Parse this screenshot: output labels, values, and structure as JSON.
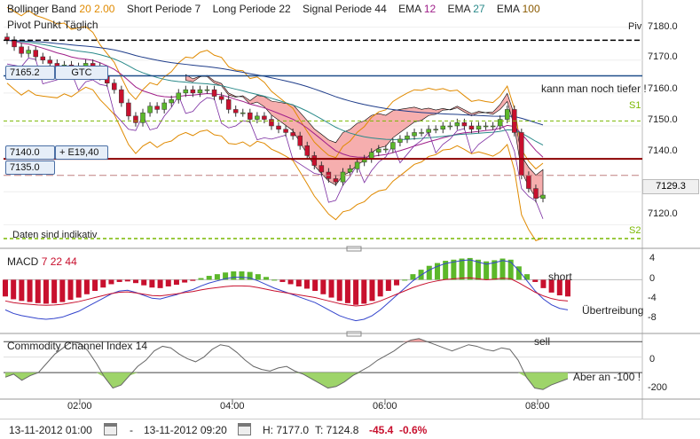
{
  "header": {
    "items": [
      {
        "label": "Bollinger Band",
        "vals": [
          "20",
          "2.00"
        ],
        "color": "#e08a00"
      },
      {
        "label": "Short Periode",
        "vals": [
          "7"
        ],
        "color": "#333333"
      },
      {
        "label": "Long Periode",
        "vals": [
          "22"
        ],
        "color": "#333333"
      },
      {
        "label": "Signal Periode",
        "vals": [
          "44"
        ],
        "color": "#333333"
      },
      {
        "label": "EMA",
        "vals": [
          "12"
        ],
        "color": "#a0208a"
      },
      {
        "label": "EMA",
        "vals": [
          "27"
        ],
        "color": "#2a8a8a"
      },
      {
        "label": "EMA",
        "vals": [
          "100"
        ],
        "color": "#8a5a00"
      }
    ],
    "subtitle": "Pivot Punkt Täglich"
  },
  "price_panel": {
    "pivot_label": "Piv",
    "s1_label": "S1",
    "s2_label": "S2",
    "indicative_note": "Daten sind indikativ",
    "annotation_top": "kann man noch tiefer !",
    "order_gtc": {
      "price": "7165.2",
      "tag": "GTC"
    },
    "order_e": {
      "price": "7140.0",
      "tag": "+ E19,40"
    },
    "order_stop": {
      "price": "7135.0"
    },
    "last_price": "7129.3",
    "y_ticks": [
      "7180.0",
      "7170.0",
      "7160.0",
      "7150.0",
      "7140.0",
      "7120.0"
    ]
  },
  "macd_panel": {
    "title": "MACD",
    "params": [
      "7",
      "22",
      "44"
    ],
    "annotation_short": "short",
    "annotation_ubertreibung": "Übertreibung",
    "y_ticks": [
      "4",
      "0",
      "-4",
      "-8"
    ]
  },
  "cci_panel": {
    "title": "Commodity Channel Index",
    "param": "14",
    "annotation_sell": "sell",
    "annotation_aber": "Aber an -100 !",
    "y_ticks": [
      "0",
      "-200"
    ]
  },
  "x_axis": {
    "ticks": [
      "02:00",
      "04:00",
      "06:00",
      "08:00"
    ]
  },
  "footer": {
    "from": "13-11-2012 01:00",
    "dash": "-",
    "to": "13-11-2012 09:20",
    "high": "H: 7177.0",
    "low": "T: 7124.8",
    "change": "-45.4",
    "change_pct": "-0.6%"
  },
  "colors": {
    "up": "#5cb82a",
    "down": "#c8102e",
    "cloud": "#f5a0a0",
    "pivot": "#000000",
    "support": "#7ab800",
    "resistance_line": "#8b0000",
    "gtc_line": "#1f4e8a"
  },
  "chart_data": [
    {
      "type": "candlestick",
      "title": "Bollinger Band 20 2.00",
      "ylim": [
        7115,
        7185
      ],
      "pivot": 7176,
      "s1": 7151.5,
      "s2": 7105,
      "close": [
        7176,
        7174,
        7172,
        7173,
        7171,
        7170,
        7169,
        7168,
        7168.5,
        7167,
        7168,
        7169,
        7168,
        7165,
        7163,
        7161,
        7157,
        7153,
        7151,
        7154,
        7156,
        7155,
        7157,
        7158,
        7160,
        7161,
        7160,
        7161,
        7161,
        7159,
        7158,
        7155,
        7154,
        7154,
        7152,
        7153,
        7152,
        7150,
        7149,
        7148,
        7147,
        7144,
        7141,
        7138,
        7136,
        7134,
        7133,
        7136,
        7137,
        7139,
        7140,
        7142,
        7143,
        7143,
        7145,
        7146,
        7147,
        7148,
        7148,
        7149,
        7149,
        7150,
        7150,
        7151,
        7150,
        7149,
        7150,
        7150,
        7150,
        7152,
        7155,
        7148,
        7135,
        7131,
        7128,
        7129
      ]
    },
    {
      "type": "bar",
      "title": "MACD 7 22 44",
      "ylim": [
        -9,
        5
      ],
      "values": [
        -3,
        -3.5,
        -3.8,
        -4,
        -4.2,
        -4.3,
        -4.2,
        -4,
        -3.6,
        -3.2,
        -2.6,
        -2,
        -1.4,
        -0.8,
        -0.4,
        -0.3,
        -0.6,
        -1,
        -1.4,
        -1.5,
        -1.2,
        -0.9,
        -0.5,
        -0.2,
        0.3,
        0.7,
        1,
        1.3,
        1.5,
        1.5,
        1.4,
        1,
        0.5,
        0,
        -0.4,
        -0.8,
        -1.2,
        -1.6,
        -2,
        -2.6,
        -3.2,
        -3.8,
        -4.2,
        -4.5,
        -4.3,
        -3.8,
        -3,
        -2,
        -1,
        0,
        1,
        1.8,
        2.5,
        3,
        3.4,
        3.6,
        3.8,
        3.9,
        3.6,
        3.3,
        3.5,
        3.8,
        3.6,
        2.4,
        1,
        -0.4,
        -1.5,
        -2.3,
        -2.8,
        -3
      ]
    },
    {
      "type": "area",
      "title": "Commodity Channel Index 14",
      "ylim": [
        -260,
        130
      ],
      "values": [
        -130,
        -110,
        -150,
        -120,
        -100,
        -40,
        20,
        60,
        100,
        90,
        40,
        -40,
        -130,
        -200,
        -180,
        -120,
        -60,
        -20,
        40,
        70,
        60,
        20,
        -10,
        -30,
        0,
        50,
        80,
        70,
        30,
        -20,
        -60,
        -80,
        -90,
        -70,
        -60,
        -90,
        -110,
        -140,
        -170,
        -200,
        -190,
        -160,
        -120,
        -90,
        -60,
        -20,
        10,
        40,
        80,
        110,
        120,
        100,
        80,
        60,
        40,
        60,
        80,
        70,
        50,
        40,
        60,
        50,
        -20,
        -130,
        -200,
        -210,
        -180,
        -160,
        -140
      ]
    }
  ]
}
